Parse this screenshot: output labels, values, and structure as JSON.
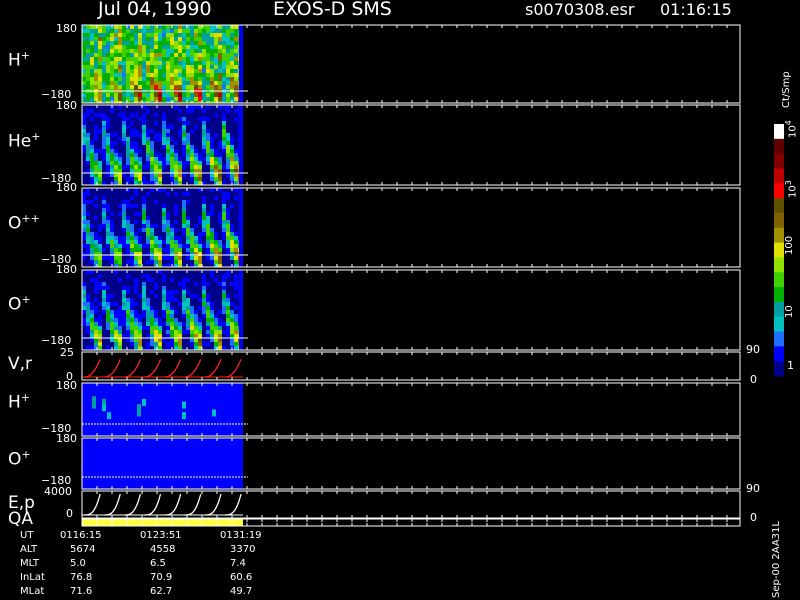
{
  "header": {
    "date": "Jul 04, 1990",
    "instrument": "EXOS-D SMS",
    "file": "s0070308.esr",
    "time": "01:16:15"
  },
  "colorbar": {
    "unit_label": "Ct/Smp",
    "tick_labels": [
      "1",
      "10",
      "100",
      "10",
      "10"
    ],
    "tick_exponents": [
      "",
      "",
      "",
      "3",
      "4"
    ],
    "colors": [
      "#00008b",
      "#0000ff",
      "#1f6fff",
      "#00c0c0",
      "#00a0a0",
      "#00b000",
      "#40d000",
      "#90e000",
      "#e0e000",
      "#a09000",
      "#806000",
      "#605000",
      "#ff0000",
      "#c00000",
      "#800000",
      "#600000",
      "#ffffff"
    ]
  },
  "side_text": "Sep-00  2AA31L",
  "ephemeris": {
    "rows": [
      {
        "label": "UT",
        "values": [
          "0116:15",
          "0123:51",
          "0131:19"
        ]
      },
      {
        "label": "ALT",
        "values": [
          "5674",
          "4558",
          "3370"
        ]
      },
      {
        "label": "MLT",
        "values": [
          "5.0",
          "6.5",
          "7.4"
        ]
      },
      {
        "label": "InLat",
        "values": [
          "76.8",
          "70.9",
          "60.6"
        ]
      },
      {
        "label": "MLat",
        "values": [
          "71.6",
          "62.7",
          "49.7"
        ]
      }
    ]
  },
  "chart_data": [
    {
      "type": "heatmap",
      "panel": "H+",
      "label": "H",
      "sup": "+",
      "ytick_top": "180",
      "ytick_bottom": "−180",
      "ylim": [
        -180,
        180
      ],
      "sweeps": 8,
      "peak_levels": [
        11,
        12,
        14,
        16,
        15,
        14,
        14,
        15
      ],
      "bg_level": 1
    },
    {
      "type": "heatmap",
      "panel": "He+",
      "label": "He",
      "sup": "+",
      "ytick_top": "180",
      "ytick_bottom": "−180",
      "ylim": [
        -180,
        180
      ],
      "sweeps": 8,
      "peak_levels": [
        8,
        9,
        9,
        10,
        10,
        11,
        12,
        13
      ],
      "bg_level": 0
    },
    {
      "type": "heatmap",
      "panel": "O++",
      "label": "O",
      "sup": "++",
      "ytick_top": "180",
      "ytick_bottom": "−180",
      "ylim": [
        -180,
        180
      ],
      "sweeps": 8,
      "peak_levels": [
        8,
        8,
        9,
        10,
        10,
        11,
        12,
        13
      ],
      "bg_level": 0
    },
    {
      "type": "heatmap",
      "panel": "O+",
      "label": "O",
      "sup": "+",
      "ytick_top": "180",
      "ytick_bottom": "−180",
      "ylim": [
        -180,
        180
      ],
      "sweeps": 8,
      "peak_levels": [
        9,
        9,
        10,
        10,
        10,
        11,
        11,
        11
      ],
      "bg_level": 0
    },
    {
      "type": "line",
      "panel": "V,r",
      "label": "V,r",
      "ytick_top": "25",
      "ytick_bottom": "0",
      "ylim": [
        0,
        25
      ],
      "right_top": "90",
      "right_bottom": "0",
      "color": "#ff2020",
      "sweeps": 8
    },
    {
      "type": "heatmap",
      "panel": "H+ (2)",
      "label": "H",
      "sup": "+",
      "ytick_top": "180",
      "ytick_bottom": "−180",
      "ylim": [
        -180,
        180
      ],
      "bg_level": 1,
      "spots": [
        [
          2,
          0.25,
          4
        ],
        [
          2,
          0.35,
          4
        ],
        [
          4,
          0.3,
          4
        ],
        [
          4,
          0.4,
          3
        ],
        [
          5,
          0.55,
          3
        ],
        [
          11,
          0.4,
          4
        ],
        [
          11,
          0.5,
          4
        ],
        [
          12,
          0.3,
          3
        ],
        [
          20,
          0.35,
          3
        ],
        [
          20,
          0.55,
          3
        ],
        [
          26,
          0.5,
          3
        ]
      ]
    },
    {
      "type": "heatmap",
      "panel": "O+ (2)",
      "label": "O",
      "sup": "+",
      "ytick_top": "180",
      "ytick_bottom": "−180",
      "ylim": [
        -180,
        180
      ],
      "bg_level": 1,
      "spots": []
    },
    {
      "type": "line",
      "panel": "E,p",
      "label": "E,p",
      "ytick_top": "4000",
      "ytick_bottom": "0",
      "ylim": [
        0,
        4000
      ],
      "right_top": "90",
      "right_bottom": "0",
      "color": "#ffffff",
      "sweeps": 8
    },
    {
      "type": "bar",
      "panel": "QA",
      "label": "QA",
      "color": "#ffff40",
      "start": 0,
      "end": 1
    }
  ]
}
